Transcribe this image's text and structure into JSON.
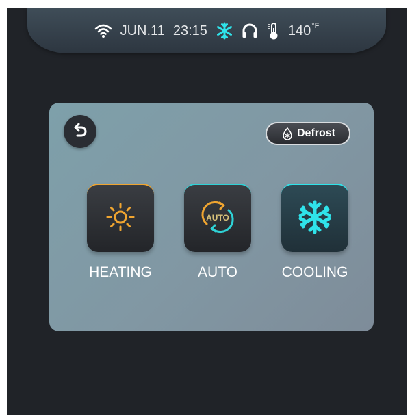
{
  "status": {
    "date": "JUN.11",
    "time": "23:15",
    "temperature": "140",
    "temp_unit": "°F",
    "icons": [
      "wifi-icon",
      "snowflake-icon",
      "headphones-icon",
      "thermometer-icon"
    ]
  },
  "panel": {
    "defrost_label": "Defrost",
    "modes": [
      {
        "label": "HEATING",
        "icon": "sun-icon",
        "accent": "#f0a530"
      },
      {
        "label": "AUTO",
        "icon": "auto-cycle-icon",
        "accent": "#2fd2d6",
        "icon_text": "AUTO"
      },
      {
        "label": "COOLING",
        "icon": "snowflake-icon",
        "accent": "#2fe3ea"
      }
    ]
  },
  "colors": {
    "background": "#202328",
    "panel": "#8197a3",
    "cooling_accent": "#2fe3ea",
    "heating_accent": "#f0a530"
  }
}
